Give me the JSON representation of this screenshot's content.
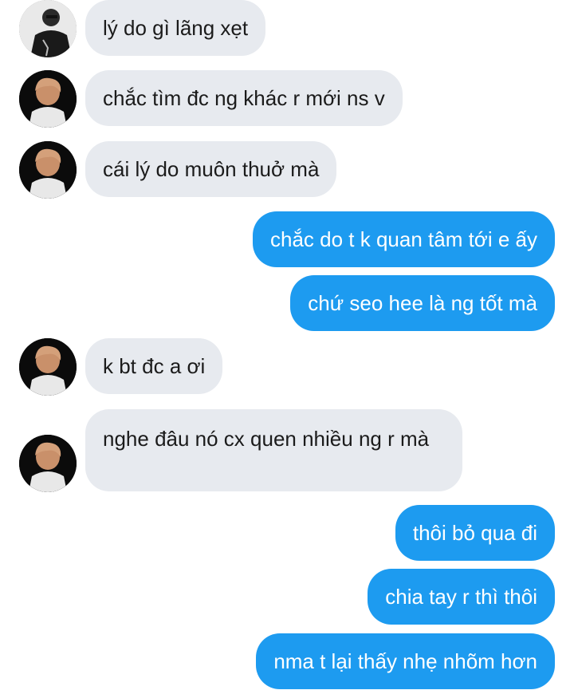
{
  "conversation": {
    "messages": [
      {
        "side": "in",
        "text": "lý do gì lãng xẹt",
        "avatar": "avatar-photo-1"
      },
      {
        "side": "in",
        "text": "chắc tìm đc ng khác r mới ns v",
        "avatar": "avatar-photo-2"
      },
      {
        "side": "in",
        "text": "cái lý do muôn thuở mà",
        "avatar": "avatar-photo-2"
      },
      {
        "side": "out",
        "text": "chắc do t k quan tâm tới e ấy"
      },
      {
        "side": "out",
        "text": "chứ seo hee là ng tốt mà"
      },
      {
        "side": "in",
        "text": "k bt đc a ơi",
        "avatar": "avatar-photo-2"
      },
      {
        "side": "in",
        "text": "nghe đâu nó cx quen nhiều ng r mà",
        "avatar": "avatar-photo-2"
      },
      {
        "side": "out",
        "text": "thôi bỏ qua đi"
      },
      {
        "side": "out",
        "text": "chia tay r thì thôi"
      },
      {
        "side": "out",
        "text": "nma t lại thấy nhẹ nhõm hơn"
      }
    ]
  },
  "colors": {
    "incoming_bubble": "#e7eaef",
    "outgoing_bubble": "#1d9bf0",
    "incoming_text": "#1b1b1b",
    "outgoing_text": "#ffffff"
  }
}
